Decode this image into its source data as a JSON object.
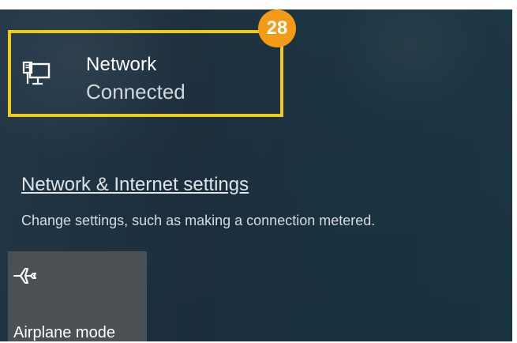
{
  "network": {
    "title": "Network",
    "status": "Connected",
    "icon": "wired-network-icon"
  },
  "badge": {
    "value": "28",
    "color": "#f39a16"
  },
  "settings": {
    "link_label": "Network & Internet settings",
    "description": "Change settings, such as making a connection metered."
  },
  "quick_actions": {
    "airplane_mode": {
      "label": "Airplane mode",
      "icon": "airplane-icon"
    }
  },
  "colors": {
    "highlight": "#efcc1a",
    "background": "#1b2d3c",
    "tile": "#4a5054"
  }
}
